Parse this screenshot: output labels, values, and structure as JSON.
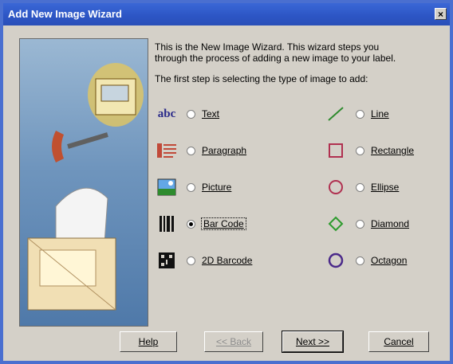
{
  "window": {
    "title": "Add New Image Wizard",
    "close_label": "×"
  },
  "intro": {
    "line1": "This is the New Image Wizard.  This wizard steps you",
    "line2": "through the process of adding a new image to your label.",
    "line3": "The first step is selecting the type of image to add:"
  },
  "options_left": [
    {
      "label": "Text",
      "icon": "text-abc-icon",
      "icon_text": "abc",
      "checked": false
    },
    {
      "label": "Paragraph",
      "icon": "paragraph-icon",
      "checked": false
    },
    {
      "label": "Picture",
      "icon": "picture-icon",
      "checked": false
    },
    {
      "label": "Bar Code",
      "icon": "barcode-icon",
      "checked": true
    },
    {
      "label": "2D Barcode",
      "icon": "2d-barcode-icon",
      "checked": false
    }
  ],
  "options_right": [
    {
      "label": "Line",
      "icon": "line-icon",
      "checked": false
    },
    {
      "label": "Rectangle",
      "icon": "rectangle-icon",
      "checked": false
    },
    {
      "label": "Ellipse",
      "icon": "ellipse-icon",
      "checked": false
    },
    {
      "label": "Diamond",
      "icon": "diamond-icon",
      "checked": false
    },
    {
      "label": "Octagon",
      "icon": "octagon-icon",
      "checked": false
    }
  ],
  "buttons": {
    "help": "Help",
    "back": "<< Back",
    "next": "Next >>",
    "cancel": "Cancel"
  },
  "colors": {
    "accent": "#2c55c4",
    "text_icon": "#2a2a8a",
    "line_icon": "#2e8b2e",
    "rect_icon": "#b03050",
    "diamond_icon": "#2e9b2e",
    "octagon_icon": "#4b2a8a"
  }
}
